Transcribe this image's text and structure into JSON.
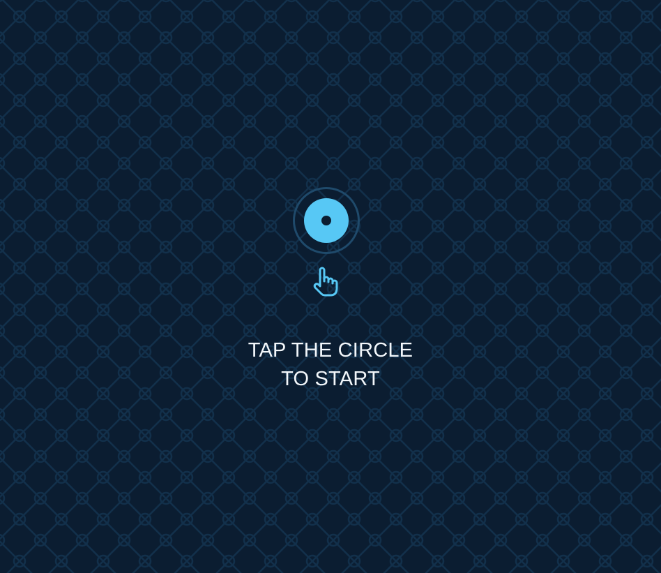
{
  "colors": {
    "background": "#0b1d31",
    "pattern": "#12304b",
    "accent": "#57c8f5",
    "ring": "#1f4a6b",
    "text": "#f3f7fb"
  },
  "start_target": {
    "icon": "target-circle-icon"
  },
  "hint": {
    "icon": "pointing-hand-icon"
  },
  "prompt": {
    "line1": "TAP THE CIRCLE",
    "line2": "TO START"
  }
}
